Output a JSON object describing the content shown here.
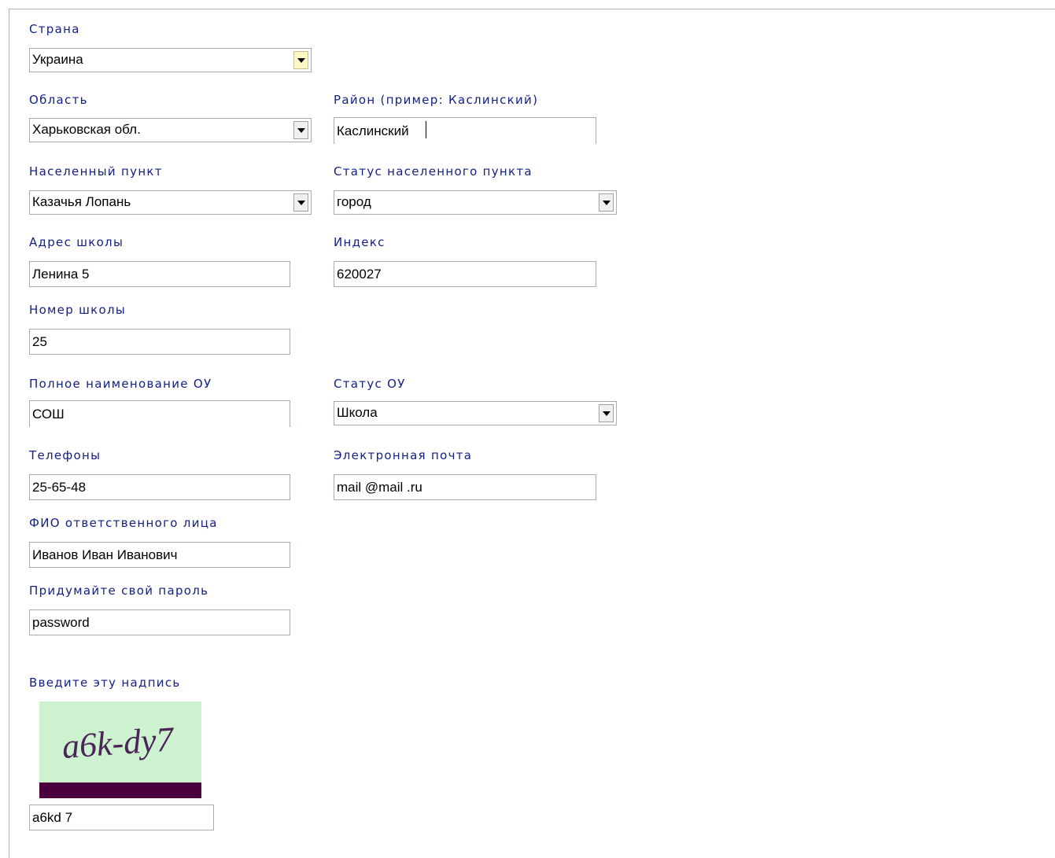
{
  "form": {
    "country": {
      "label": "Страна",
      "value": "Украина"
    },
    "region": {
      "label": "Область",
      "value": "Харьковская обл."
    },
    "district": {
      "label": "Район (пример: Каслинский)",
      "value": "Каслинский"
    },
    "settlement": {
      "label": "Населенный пункт",
      "value": "Казачья Лопань"
    },
    "settlement_status": {
      "label": "Статус населенного пункта",
      "value": "город"
    },
    "school_address": {
      "label": "Адрес школы",
      "value": "Ленина 5"
    },
    "postal_index": {
      "label": "Индекс",
      "value": "620027"
    },
    "school_number": {
      "label": "Номер школы",
      "value": "25"
    },
    "full_name_ou": {
      "label": "Полное наименование ОУ",
      "value": "СОШ"
    },
    "status_ou": {
      "label": "Статус ОУ",
      "value": "Школа"
    },
    "phones": {
      "label": "Телефоны",
      "value": "25-65-48"
    },
    "email": {
      "label": "Электронная почта",
      "value": "mail @mail .ru"
    },
    "responsible": {
      "label": "ФИО ответственного лица",
      "value": "Иванов Иван Иванович"
    },
    "password": {
      "label": "Придумайте свой пароль",
      "value": "password"
    },
    "captcha": {
      "label": "Введите эту надпись",
      "image_text": "a6k-dy7",
      "value": "a6kd 7"
    }
  },
  "colors": {
    "label": "#14208a",
    "captcha_background": "#ccf2cf",
    "captcha_bar": "#4b003e",
    "captcha_text": "#4b2458"
  }
}
